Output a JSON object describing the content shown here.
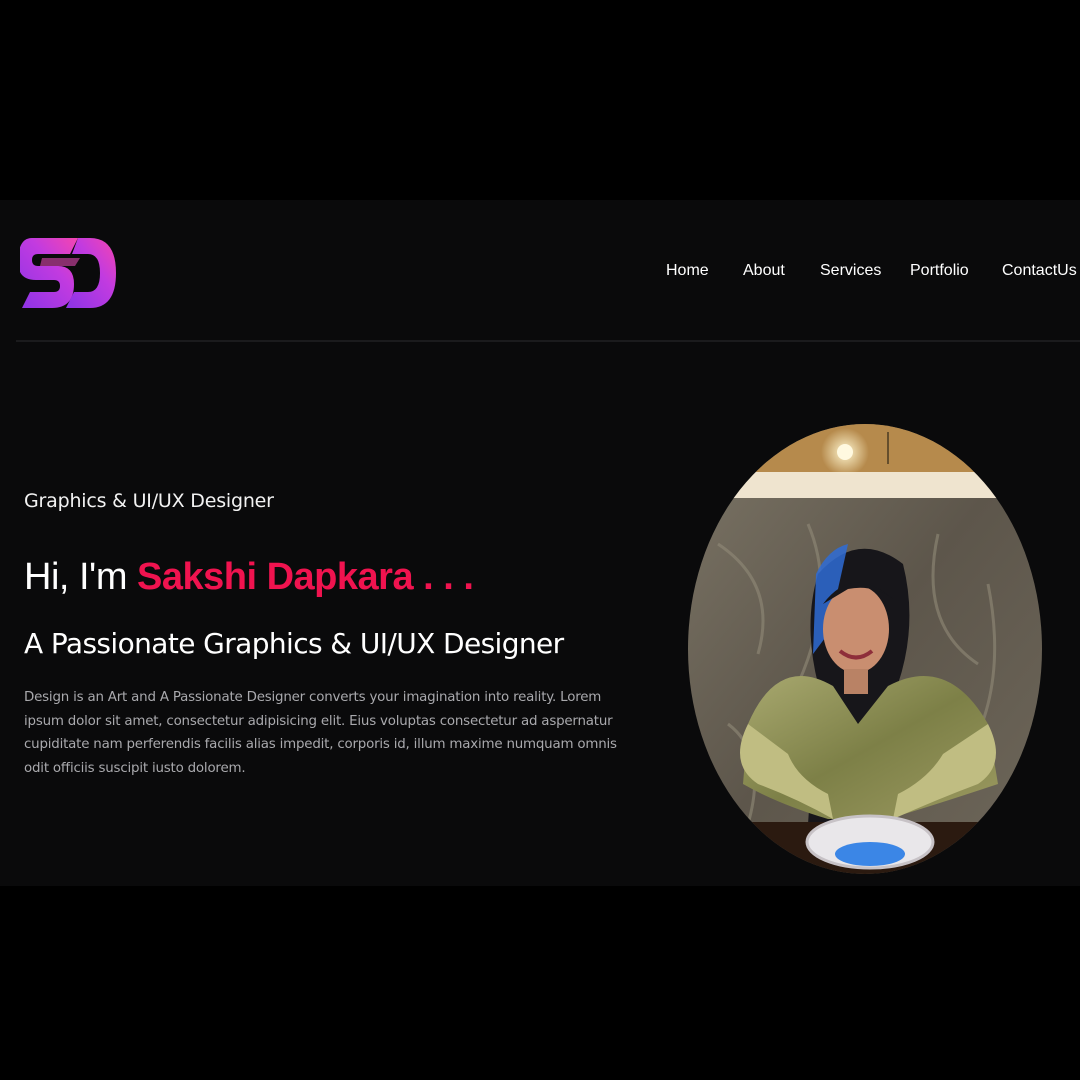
{
  "header": {
    "logo_text": "SD",
    "nav": [
      {
        "label": "Home"
      },
      {
        "label": "About"
      },
      {
        "label": "Services"
      },
      {
        "label": "Portfolio"
      },
      {
        "label": "ContactUs"
      }
    ]
  },
  "hero": {
    "subtitle": "Graphics & UI/UX Designer",
    "greeting_prefix": "Hi, I'm ",
    "name": "Sakshi Dapkara . . .",
    "tagline": "A Passionate Graphics & UI/UX Designer",
    "description": "Design is an Art and A Passionate Designer converts your imagination into reality. Lorem ipsum dolor sit amet, consectetur adipisicing elit. Eius voluptas consectetur ad aspernatur cupiditate nam perferendis facilis alias impedit, corporis id, illum maxime numquam omnis odit officiis suscipit iusto dolorem."
  },
  "colors": {
    "background": "#0a0a0b",
    "accent": "#f0134f",
    "logo_gradient_start": "#a13cf0",
    "logo_gradient_end": "#f23db7"
  }
}
